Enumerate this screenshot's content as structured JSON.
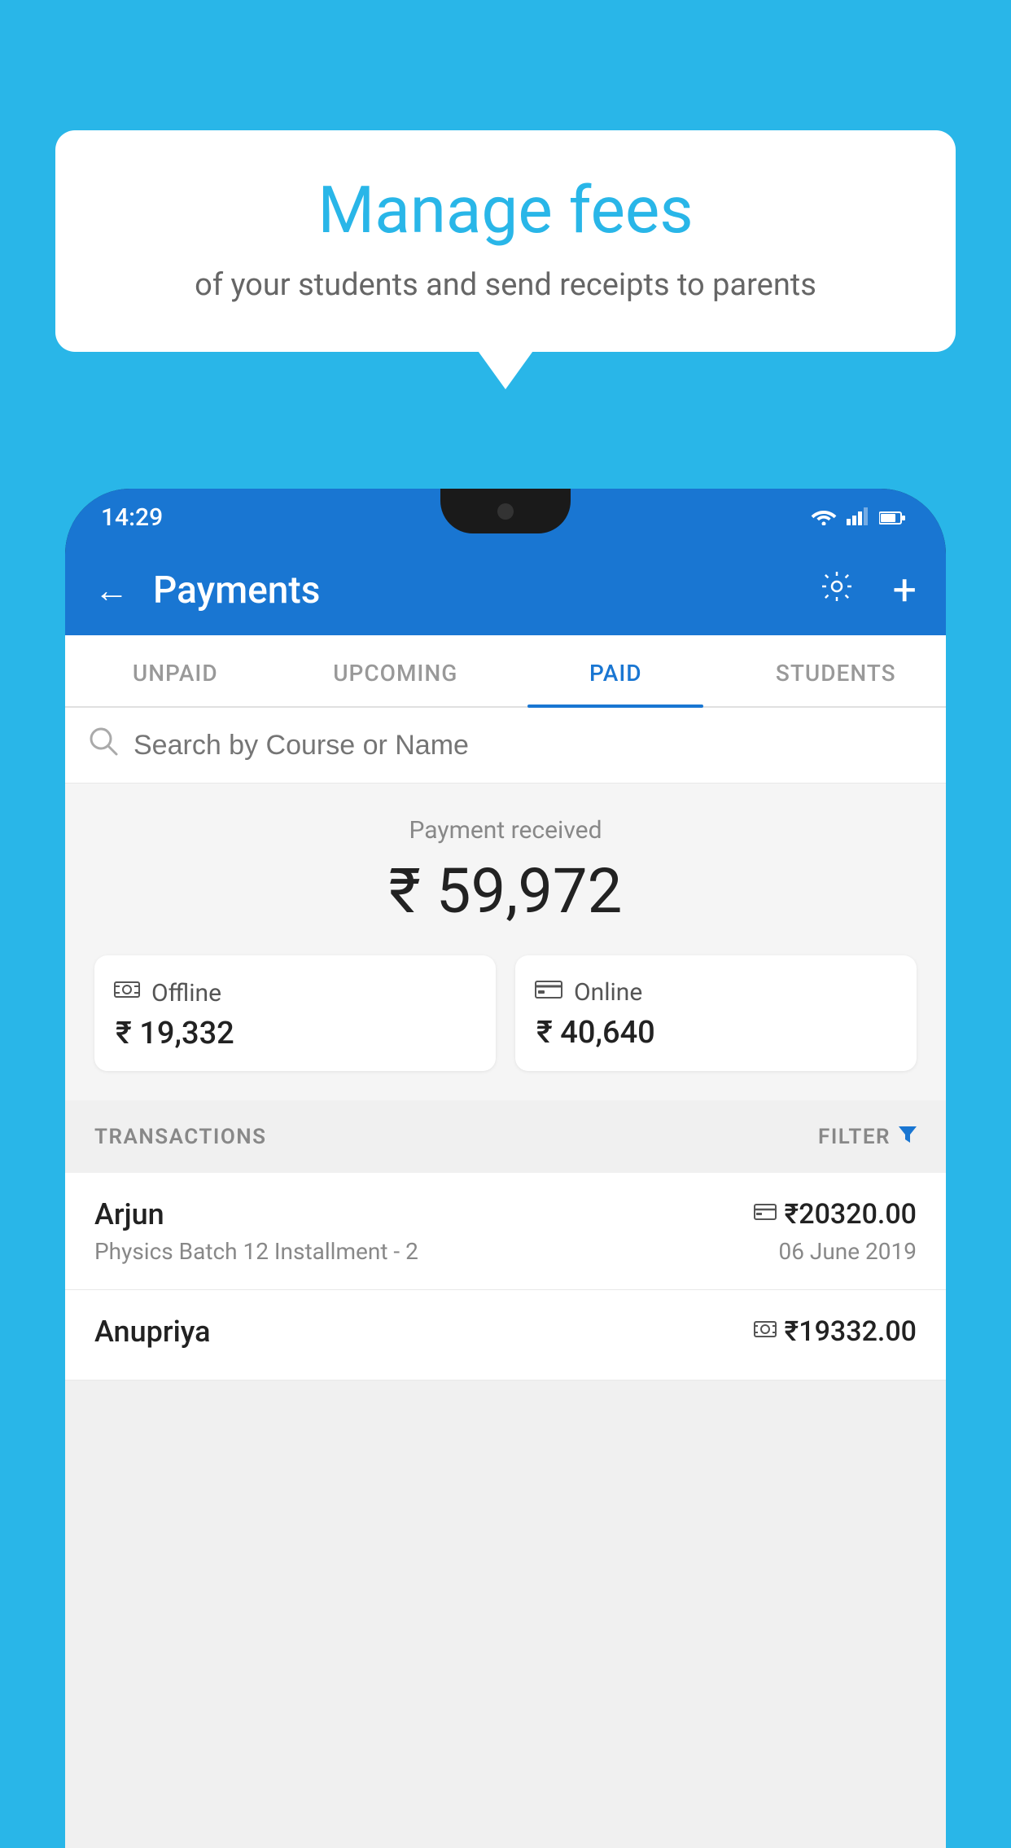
{
  "background_color": "#29b6e8",
  "bubble": {
    "title": "Manage fees",
    "subtitle": "of your students and send receipts to parents"
  },
  "status_bar": {
    "time": "14:29",
    "wifi": "▲",
    "signal": "▲",
    "battery": "▐"
  },
  "app_bar": {
    "title": "Payments",
    "back_icon": "←",
    "gear_icon": "⚙",
    "plus_icon": "+"
  },
  "tabs": [
    {
      "label": "UNPAID",
      "active": false
    },
    {
      "label": "UPCOMING",
      "active": false
    },
    {
      "label": "PAID",
      "active": true
    },
    {
      "label": "STUDENTS",
      "active": false
    }
  ],
  "search": {
    "placeholder": "Search by Course or Name"
  },
  "payment_summary": {
    "label": "Payment received",
    "total": "₹ 59,972",
    "offline_label": "Offline",
    "offline_amount": "₹ 19,332",
    "online_label": "Online",
    "online_amount": "₹ 40,640"
  },
  "transactions": {
    "section_label": "TRANSACTIONS",
    "filter_label": "FILTER",
    "items": [
      {
        "name": "Arjun",
        "course": "Physics Batch 12 Installment - 2",
        "amount": "₹20320.00",
        "date": "06 June 2019",
        "mode": "card"
      },
      {
        "name": "Anupriya",
        "course": "",
        "amount": "₹19332.00",
        "date": "",
        "mode": "cash"
      }
    ]
  }
}
